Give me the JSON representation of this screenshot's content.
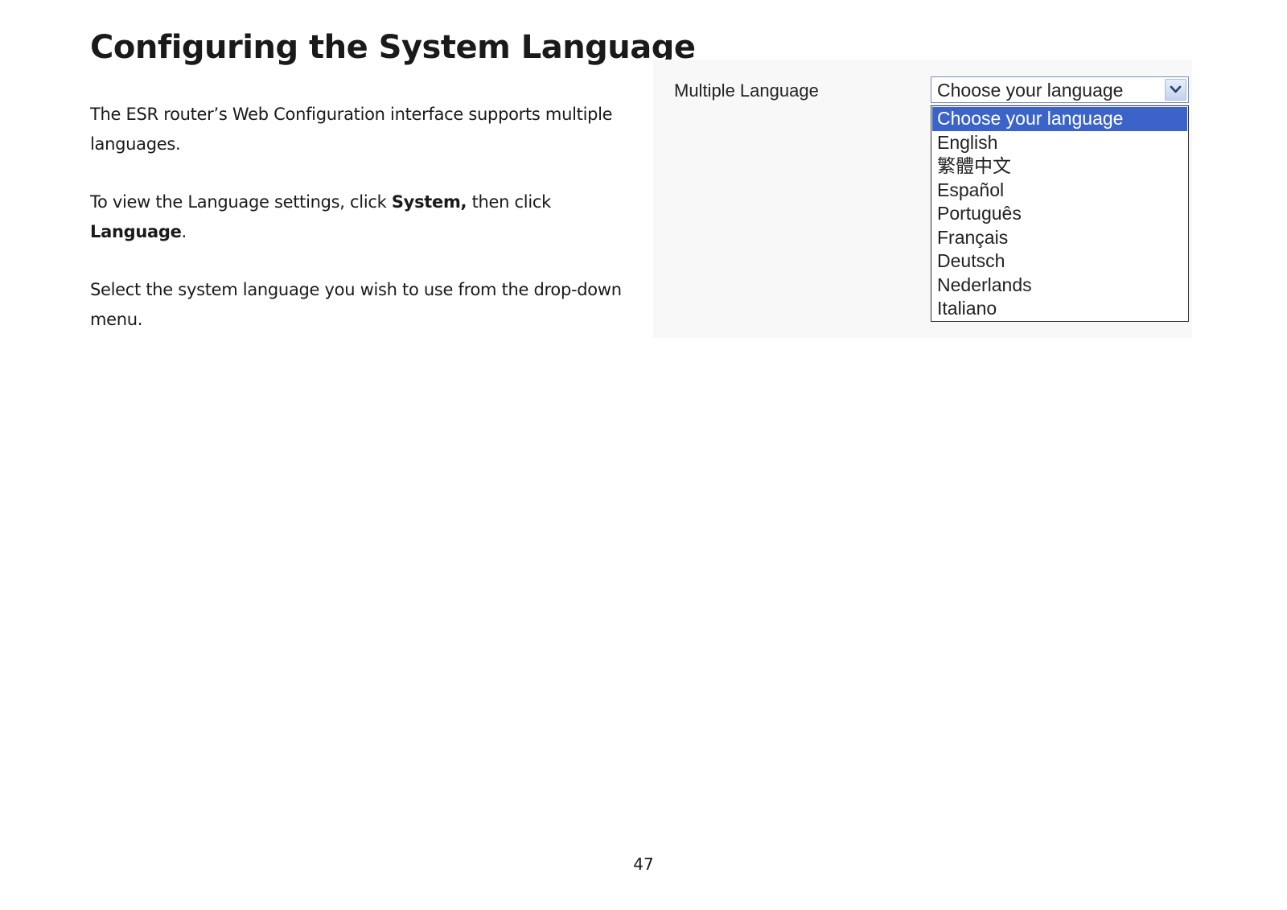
{
  "page": {
    "title": "Configuring the System Language",
    "paragraph1": "The ESR router’s Web Configuration interface supports multiple languages.",
    "paragraph2": {
      "before": "To view the Language settings, click ",
      "bold1": "System,",
      "middle": " then click ",
      "bold2": "Language",
      "after": "."
    },
    "paragraph3": "Select the system language you wish to use from the drop-down menu.",
    "page_number": "47"
  },
  "figure": {
    "field_label": "Multiple Language",
    "select": {
      "value": "Choose your language",
      "arrow_icon": "chevron-down-icon"
    },
    "options": [
      "Choose your language",
      "English",
      "繁體中文",
      "Español",
      "Português",
      "Français",
      "Deutsch",
      "Nederlands",
      "Italiano"
    ],
    "highlighted_option": "Choose your language",
    "colors": {
      "highlight": "#3c64c8",
      "highlight_text": "#ffffff"
    }
  }
}
